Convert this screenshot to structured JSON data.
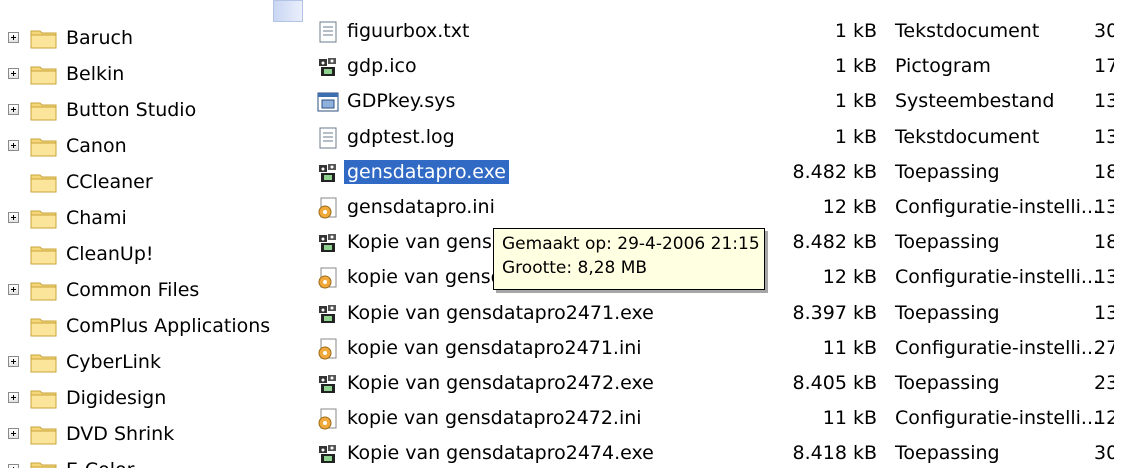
{
  "tree": {
    "items": [
      {
        "label": "Baruch",
        "expandable": true
      },
      {
        "label": "Belkin",
        "expandable": true
      },
      {
        "label": "Button Studio",
        "expandable": true
      },
      {
        "label": "Canon",
        "expandable": true
      },
      {
        "label": "CCleaner",
        "expandable": false
      },
      {
        "label": "Chami",
        "expandable": true
      },
      {
        "label": "CleanUp!",
        "expandable": false
      },
      {
        "label": "Common Files",
        "expandable": true
      },
      {
        "label": "ComPlus Applications",
        "expandable": false
      },
      {
        "label": "CyberLink",
        "expandable": true
      },
      {
        "label": "Digidesign",
        "expandable": true
      },
      {
        "label": "DVD Shrink",
        "expandable": true
      },
      {
        "label": "E-Color",
        "expandable": true
      }
    ]
  },
  "files": [
    {
      "name": "figuurbox.txt",
      "size": "1 kB",
      "type": "Tekstdocument",
      "date": "30",
      "icon": "text-icon"
    },
    {
      "name": "gdp.ico",
      "size": "1 kB",
      "type": "Pictogram",
      "date": "17",
      "icon": "app-icon"
    },
    {
      "name": "GDPkey.sys",
      "size": "1 kB",
      "type": "Systeembestand",
      "date": "13",
      "icon": "system-file-icon"
    },
    {
      "name": "gdptest.log",
      "size": "1 kB",
      "type": "Tekstdocument",
      "date": "13",
      "icon": "text-icon"
    },
    {
      "name": "gensdatapro.exe",
      "size": "8.482 kB",
      "type": "Toepassing",
      "date": "18",
      "icon": "app-icon",
      "selected": true
    },
    {
      "name": "gensdatapro.ini",
      "size": "12 kB",
      "type": "Configuratie-instelli...",
      "date": "13",
      "icon": "config-icon"
    },
    {
      "name": "Kopie van gensdat",
      "size": "8.482 kB",
      "type": "Toepassing",
      "date": "18",
      "icon": "app-icon"
    },
    {
      "name": "kopie van gensdat",
      "size": "12 kB",
      "type": "Configuratie-instelli...",
      "date": "13",
      "icon": "config-icon"
    },
    {
      "name": "Kopie van gensdatapro2471.exe",
      "size": "8.397 kB",
      "type": "Toepassing",
      "date": "13",
      "icon": "app-icon"
    },
    {
      "name": "kopie van gensdatapro2471.ini",
      "size": "11 kB",
      "type": "Configuratie-instelli...",
      "date": "27",
      "icon": "config-icon"
    },
    {
      "name": "Kopie van gensdatapro2472.exe",
      "size": "8.405 kB",
      "type": "Toepassing",
      "date": "23",
      "icon": "app-icon"
    },
    {
      "name": "kopie van gensdatapro2472.ini",
      "size": "11 kB",
      "type": "Configuratie-instelli...",
      "date": "12",
      "icon": "config-icon"
    },
    {
      "name": "Kopie van gensdatapro2474.exe",
      "size": "8.418 kB",
      "type": "Toepassing",
      "date": "30",
      "icon": "app-icon"
    }
  ],
  "tooltip": {
    "created": "Gemaakt op: 29-4-2006 21:15",
    "size": "Grootte: 8,28 MB"
  },
  "colors": {
    "selection": "#316ac5",
    "tooltip_bg": "#ffffe1",
    "folder": "#f5d67a"
  }
}
